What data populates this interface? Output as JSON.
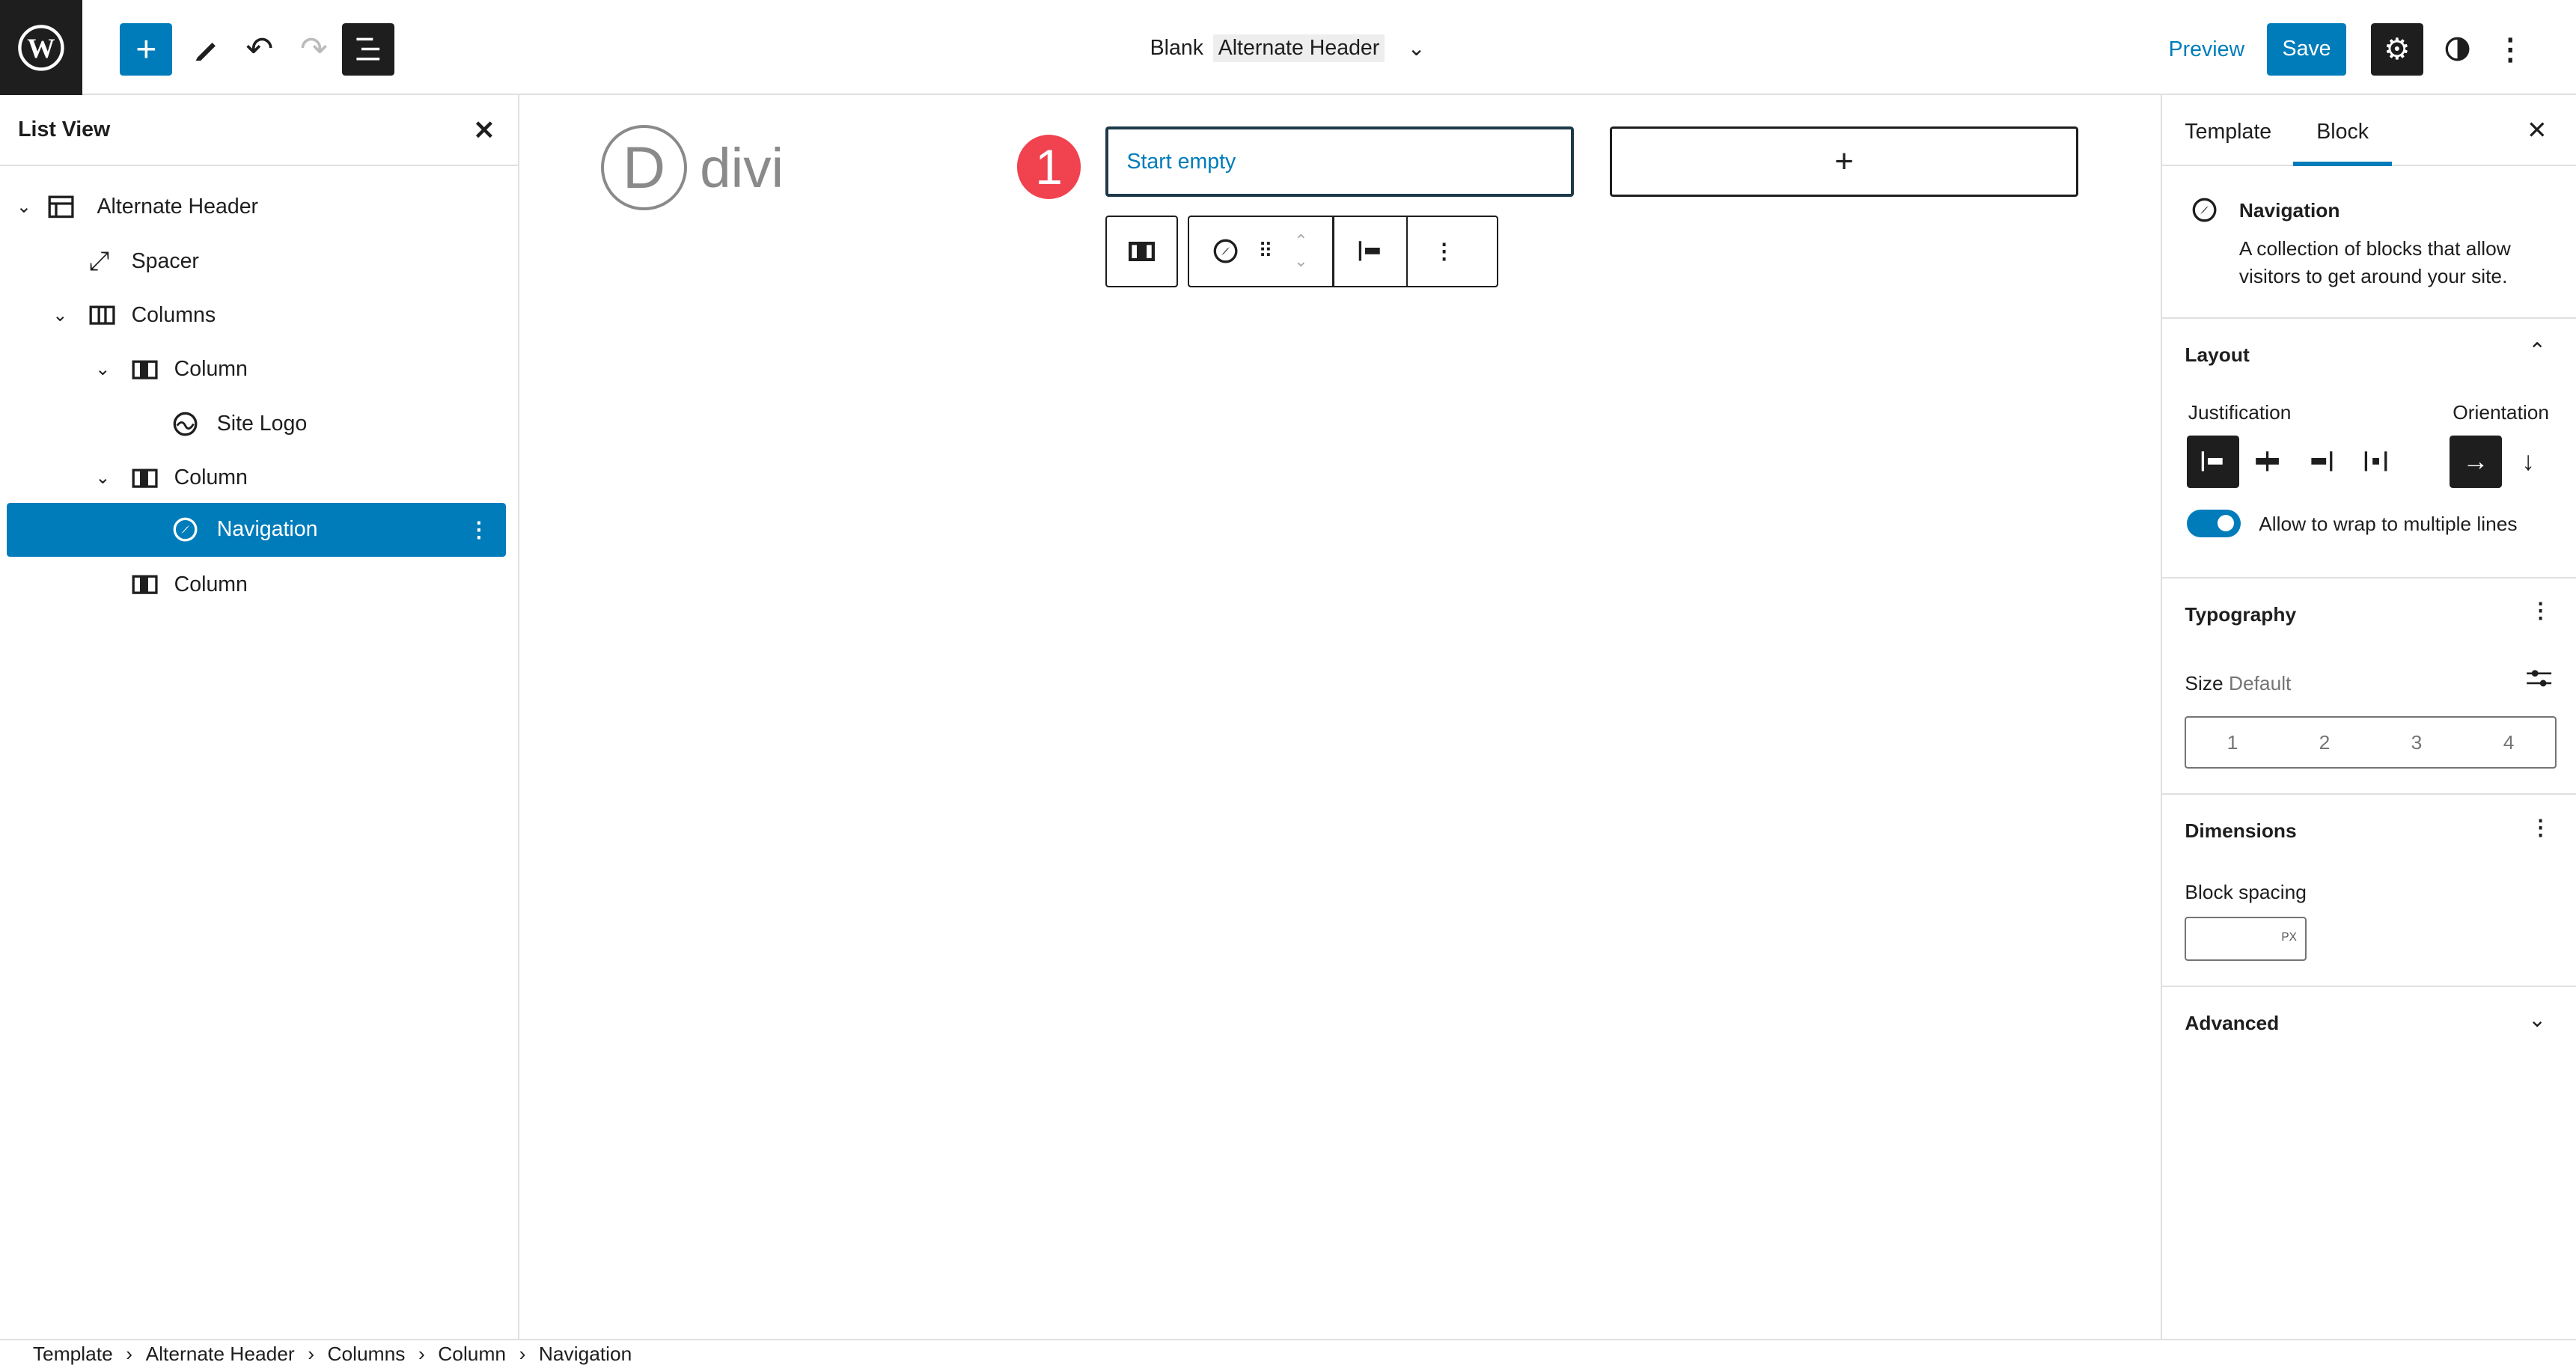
{
  "header": {
    "template_prefix": "Blank",
    "template_name": "Alternate Header",
    "preview": "Preview",
    "save": "Save"
  },
  "list_view": {
    "title": "List View",
    "items": [
      {
        "label": "Alternate Header",
        "icon": "template-part-icon"
      },
      {
        "label": "Spacer",
        "icon": "resize-icon"
      },
      {
        "label": "Columns",
        "icon": "columns-icon"
      },
      {
        "label": "Column",
        "icon": "column-icon"
      },
      {
        "label": "Site Logo",
        "icon": "site-logo-icon"
      },
      {
        "label": "Column",
        "icon": "column-icon"
      },
      {
        "label": "Navigation",
        "icon": "compass-icon"
      },
      {
        "label": "Column",
        "icon": "column-icon"
      }
    ]
  },
  "canvas": {
    "logo_text": "divi",
    "logo_letter": "D",
    "badge": "1",
    "start_empty": "Start empty",
    "add": "+"
  },
  "sidebar": {
    "tabs": [
      "Template",
      "Block"
    ],
    "block_name": "Navigation",
    "block_desc": "A collection of blocks that allow visitors to get around your site.",
    "layout": {
      "title": "Layout",
      "justification": "Justification",
      "orientation": "Orientation",
      "wrap_label": "Allow to wrap to multiple lines",
      "wrap_on": true
    },
    "typography": {
      "title": "Typography",
      "size_label": "Size",
      "size_value": "Default",
      "sizes": [
        "1",
        "2",
        "3",
        "4"
      ]
    },
    "dimensions": {
      "title": "Dimensions",
      "spacing_label": "Block spacing",
      "unit": "PX"
    },
    "advanced": {
      "title": "Advanced"
    }
  },
  "breadcrumb": [
    "Template",
    "Alternate Header",
    "Columns",
    "Column",
    "Navigation"
  ],
  "colors": {
    "accent": "#007cba",
    "badge": "#f0424f"
  }
}
